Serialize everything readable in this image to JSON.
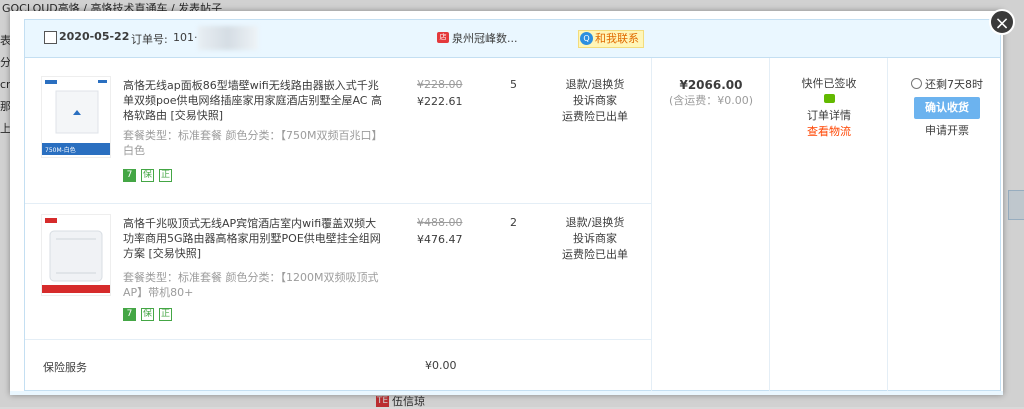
{
  "background": {
    "crumb": "GOCLOUD高恪 / 高恪技术直通车 / 发表帖子",
    "left_letters": [
      "表",
      "分",
      "cr",
      "那",
      "上"
    ],
    "bottom_badge": "TE",
    "bottom_text": "伍信琼"
  },
  "close_label": "×",
  "order": {
    "date": "2020-05-22",
    "order_no_label": "订单号:",
    "order_no": "101·",
    "shop_icon": "店",
    "shop_name": "泉州冠峰数...",
    "contact_label": "和我联系",
    "contact_icon": "Q",
    "total_amount": "¥2066.00",
    "shipping_note": "(含运费：¥0.00)",
    "status": "快件已签收",
    "order_detail": "订单详情",
    "view_logistics": "查看物流",
    "countdown": "还剩7天8时",
    "confirm_button": "确认收货",
    "invoice_link": "申请开票",
    "items": [
      {
        "title": "高恪无线ap面板86型墙壁wifi无线路由器嵌入式千兆单双频poe供电网络插座家用家庭酒店别墅全屋AC 高格软路由 [交易快照]",
        "sku": "套餐类型：标准套餐  颜色分类：【750M双频百兆口】白色",
        "image_caption": "750M-白色",
        "orig_price": "¥228.00",
        "price": "¥222.61",
        "qty": "5",
        "svc": [
          "退款/退换货",
          "投诉商家",
          "运费险已出单"
        ],
        "tags": [
          "7",
          "保",
          "正"
        ]
      },
      {
        "title": "高恪千兆吸顶式无线AP宾馆酒店室内wifi覆盖双频大功率商用5G路由器高格家用别墅POE供电壁挂全组网方案 [交易快照]",
        "sku": "套餐类型：标准套餐  颜色分类：【1200M双频吸顶式AP】带机80+",
        "image_caption": "",
        "orig_price": "¥488.00",
        "price": "¥476.47",
        "qty": "2",
        "svc": [
          "退款/退换货",
          "投诉商家",
          "运费险已出单"
        ],
        "tags": [
          "7",
          "保",
          "正"
        ]
      }
    ],
    "insurance_label": "保险服务",
    "insurance_value": "¥0.00"
  },
  "colors": {
    "header_bg": "#eaf7ff",
    "confirm_bg": "#6cb3ef",
    "logistics": "#ff4400",
    "tag_green": "#44a645"
  }
}
